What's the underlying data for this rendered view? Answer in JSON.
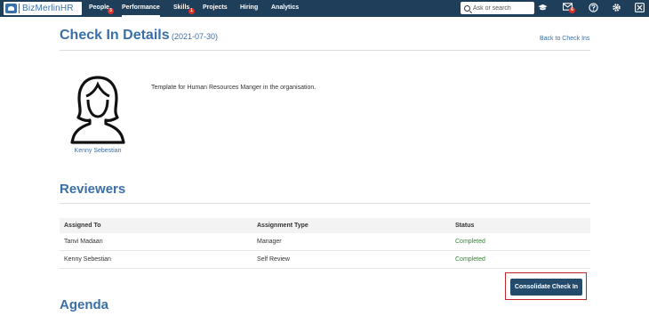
{
  "app": {
    "logo_text": "BizMerlinHR"
  },
  "nav": {
    "items": [
      {
        "label": "People",
        "badge": "3"
      },
      {
        "label": "Performance"
      },
      {
        "label": "Skills",
        "badge": "1"
      },
      {
        "label": "Projects"
      },
      {
        "label": "Hiring"
      },
      {
        "label": "Analytics"
      }
    ],
    "active": "Performance",
    "search_placeholder": "Ask or search",
    "mail_badge": "6"
  },
  "page": {
    "title": "Check In Details",
    "date": "(2021-07-30)",
    "back_link": "Back to Check Ins",
    "description": "Template for Human Resources Manger in the organisation.",
    "employee_name": "Kenny Sebestian"
  },
  "reviewers": {
    "title": "Reviewers",
    "columns": [
      "Assigned To",
      "Assignment Type",
      "Status"
    ],
    "rows": [
      {
        "assigned_to": "Tanvi Madaan",
        "type": "Manager",
        "status": "Completed"
      },
      {
        "assigned_to": "Kenny Sebestian",
        "type": "Self Review",
        "status": "Completed"
      }
    ],
    "consolidate_label": "Consolidate Check In"
  },
  "agenda": {
    "title": "Agenda"
  },
  "colors": {
    "nav_bg": "#1f3e5a",
    "accent": "#3a6fa8",
    "completed": "#2e8b2e",
    "badge": "#d9342b",
    "highlight": "#c0262c"
  }
}
